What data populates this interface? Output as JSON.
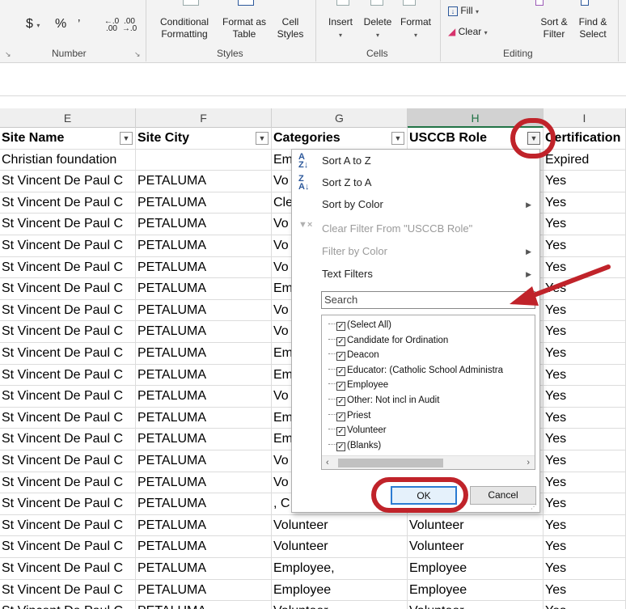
{
  "ribbon": {
    "number_group": {
      "label": "Number",
      "currency": "$",
      "percent": "%",
      "comma": "’",
      "inc_decimal": "←.0 .00",
      "dec_decimal": ".00 →.0"
    },
    "styles_group": {
      "label": "Styles",
      "buttons": [
        "Conditional Formatting",
        "Format as Table",
        "Cell Styles"
      ]
    },
    "cells_group": {
      "label": "Cells",
      "buttons": [
        "Insert",
        "Delete",
        "Format"
      ]
    },
    "editing_group": {
      "label": "Editing",
      "fill": "Fill",
      "clear": "Clear",
      "buttons": [
        "Sort & Filter",
        "Find & Select"
      ]
    }
  },
  "column_headers": [
    "E",
    "F",
    "G",
    "H",
    "I"
  ],
  "selected_column": "H",
  "table_headers": [
    "Site Name",
    "Site City",
    "Categories",
    "USCCB Role",
    "Certification"
  ],
  "rows": [
    {
      "site": "Christian foundation",
      "city": "",
      "cat": "Em",
      "role": "",
      "cert": "Expired"
    },
    {
      "site": "St Vincent De Paul C",
      "city": "PETALUMA",
      "cat": "Vo",
      "role": "",
      "cert": "Yes"
    },
    {
      "site": "St Vincent De Paul C",
      "city": "PETALUMA",
      "cat": "Cle",
      "role": "",
      "cert": "Yes"
    },
    {
      "site": "St Vincent De Paul C",
      "city": "PETALUMA",
      "cat": "Vo",
      "role": "",
      "cert": "Yes"
    },
    {
      "site": "St Vincent De Paul C",
      "city": "PETALUMA",
      "cat": "Vo",
      "role": "",
      "cert": "Yes"
    },
    {
      "site": "St Vincent De Paul C",
      "city": "PETALUMA",
      "cat": "Vo",
      "role": "",
      "cert": "Yes"
    },
    {
      "site": "St Vincent De Paul C",
      "city": "PETALUMA",
      "cat": "Em",
      "role": "",
      "cert": "Yes"
    },
    {
      "site": "St Vincent De Paul C",
      "city": "PETALUMA",
      "cat": "Vo",
      "role": "",
      "cert": "Yes"
    },
    {
      "site": "St Vincent De Paul C",
      "city": "PETALUMA",
      "cat": "Vo",
      "role": "",
      "cert": "Yes"
    },
    {
      "site": "St Vincent De Paul C",
      "city": "PETALUMA",
      "cat": "Em",
      "role": "",
      "cert": "Yes"
    },
    {
      "site": "St Vincent De Paul C",
      "city": "PETALUMA",
      "cat": "Em",
      "role": "",
      "cert": "Yes"
    },
    {
      "site": "St Vincent De Paul C",
      "city": "PETALUMA",
      "cat": "Vo",
      "role": "",
      "cert": "Yes"
    },
    {
      "site": "St Vincent De Paul C",
      "city": "PETALUMA",
      "cat": "Em",
      "role": "",
      "cert": "Yes"
    },
    {
      "site": "St Vincent De Paul C",
      "city": "PETALUMA",
      "cat": "Em",
      "role": "",
      "cert": "Yes"
    },
    {
      "site": "St Vincent De Paul C",
      "city": "PETALUMA",
      "cat": "Vo",
      "role": "",
      "cert": "Yes"
    },
    {
      "site": "St Vincent De Paul C",
      "city": "PETALUMA",
      "cat": "Vo",
      "role": "",
      "cert": "Yes"
    },
    {
      "site": "St Vincent De Paul C",
      "city": "PETALUMA",
      "cat": ", C",
      "role": "",
      "cert": "Yes"
    },
    {
      "site": "St Vincent De Paul C",
      "city": "PETALUMA",
      "cat": "Volunteer",
      "role": "Volunteer",
      "cert": "Yes"
    },
    {
      "site": "St Vincent De Paul C",
      "city": "PETALUMA",
      "cat": "Volunteer",
      "role": "Volunteer",
      "cert": "Yes"
    },
    {
      "site": "St Vincent De Paul C",
      "city": "PETALUMA",
      "cat": "Employee,",
      "role": "Employee",
      "cert": "Yes"
    },
    {
      "site": "St Vincent De Paul C",
      "city": "PETALUMA",
      "cat": "Employee",
      "role": "Employee",
      "cert": "Yes"
    },
    {
      "site": "St Vincent De Paul C",
      "city": "PETALUMA",
      "cat": "Volunteer",
      "role": "Volunteer",
      "cert": "Yes"
    }
  ],
  "filter_menu": {
    "sort_az": "Sort A to Z",
    "sort_za": "Sort Z to A",
    "sort_by_color": "Sort by Color",
    "clear_filter": "Clear Filter From \"USCCB Role\"",
    "filter_by_color": "Filter by Color",
    "text_filters": "Text Filters",
    "search_placeholder": "Search",
    "items": [
      {
        "label": "(Select All)",
        "checked": true
      },
      {
        "label": "Candidate for Ordination",
        "checked": true
      },
      {
        "label": "Deacon",
        "checked": true
      },
      {
        "label": "Educator: (Catholic School Administra",
        "checked": true
      },
      {
        "label": "Employee",
        "checked": true
      },
      {
        "label": "Other: Not incl in Audit",
        "checked": true
      },
      {
        "label": "Priest",
        "checked": true
      },
      {
        "label": "Volunteer",
        "checked": true
      },
      {
        "label": "(Blanks)",
        "checked": true
      }
    ],
    "ok_label": "OK",
    "cancel_label": "Cancel"
  },
  "annotation_color": "#c0232a",
  "excel_green": "#217346"
}
